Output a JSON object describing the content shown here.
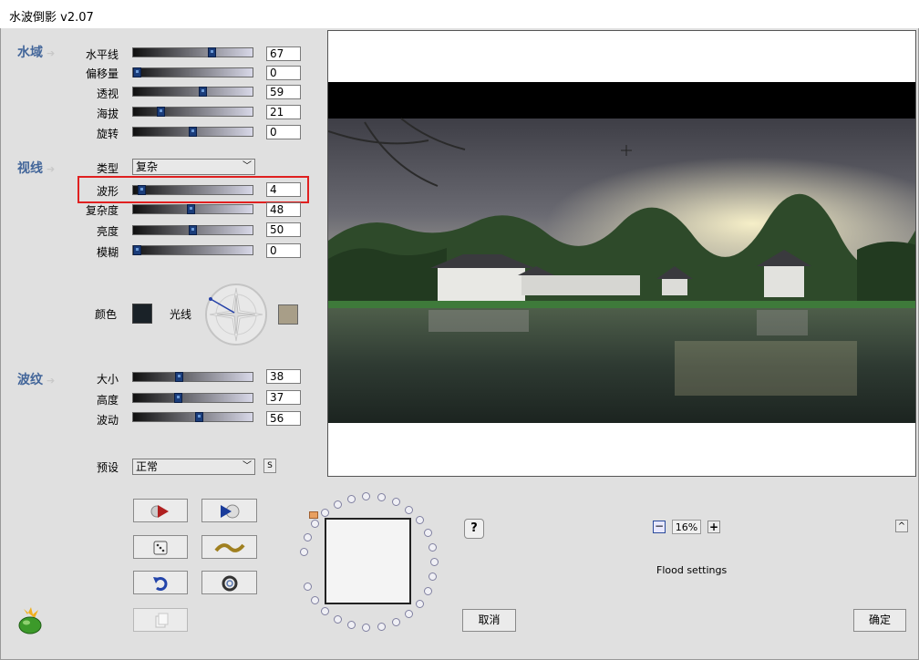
{
  "window": {
    "title": "水波倒影 v2.07"
  },
  "sections": {
    "water": "水域",
    "view": "视线",
    "ripple": "波纹"
  },
  "water": {
    "horizon": {
      "label": "水平线",
      "value": "67",
      "level": 0.67
    },
    "offset": {
      "label": "偏移量",
      "value": "0",
      "level": 0.0
    },
    "perspective": {
      "label": "透视",
      "value": "59",
      "level": 0.59
    },
    "altitude": {
      "label": "海拔",
      "value": "21",
      "level": 0.21
    },
    "rotation": {
      "label": "旋转",
      "value": "0",
      "level": 0.5
    }
  },
  "view": {
    "type": {
      "label": "类型",
      "value": "复杂"
    },
    "wave": {
      "label": "波形",
      "value": "4",
      "level": 0.04
    },
    "complexity": {
      "label": "复杂度",
      "value": "48",
      "level": 0.48
    },
    "brightness": {
      "label": "亮度",
      "value": "50",
      "level": 0.5
    },
    "blur": {
      "label": "模糊",
      "value": "0",
      "level": 0.0
    },
    "color_label": "颜色",
    "color": "#1a2228",
    "light_label": "光线",
    "light_color": "#a89e88"
  },
  "ripple": {
    "size": {
      "label": "大小",
      "value": "38",
      "level": 0.38
    },
    "height": {
      "label": "高度",
      "value": "37",
      "level": 0.37
    },
    "motion": {
      "label": "波动",
      "value": "56",
      "level": 0.56
    }
  },
  "preset": {
    "label": "预设",
    "value": "正常",
    "save": "S"
  },
  "buttons": {
    "cancel": "取消",
    "ok": "确定",
    "help": "?",
    "up": "^"
  },
  "zoom": {
    "minus": "−",
    "value": "16%",
    "plus": "+"
  },
  "flood_label": "Flood settings",
  "colors": {
    "accent": "#43669a",
    "highlight": "#e02020",
    "thumb": "#1a3c7a"
  }
}
